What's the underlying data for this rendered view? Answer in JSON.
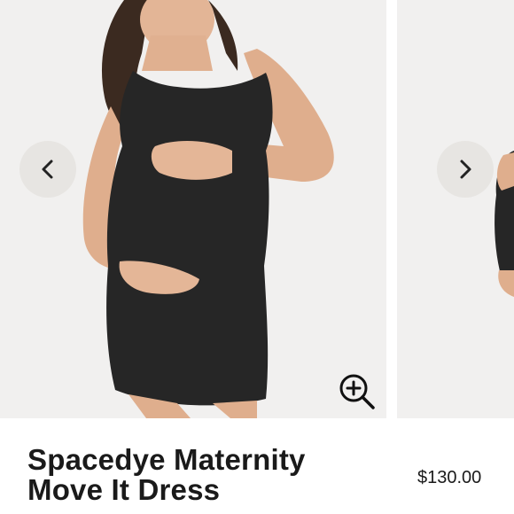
{
  "product": {
    "title_line1": "Spacedye Maternity",
    "title_line2": "Move It Dress",
    "price": "$130.00"
  },
  "gallery": {
    "prev_icon": "chevron-left-icon",
    "next_icon": "chevron-right-icon",
    "zoom_icon": "zoom-in-icon",
    "image_description_main": "model wearing black maternity dress",
    "colors": {
      "dress": "#262626",
      "background": "#f1f0ef",
      "nav_button": "#e7e5e2"
    }
  }
}
